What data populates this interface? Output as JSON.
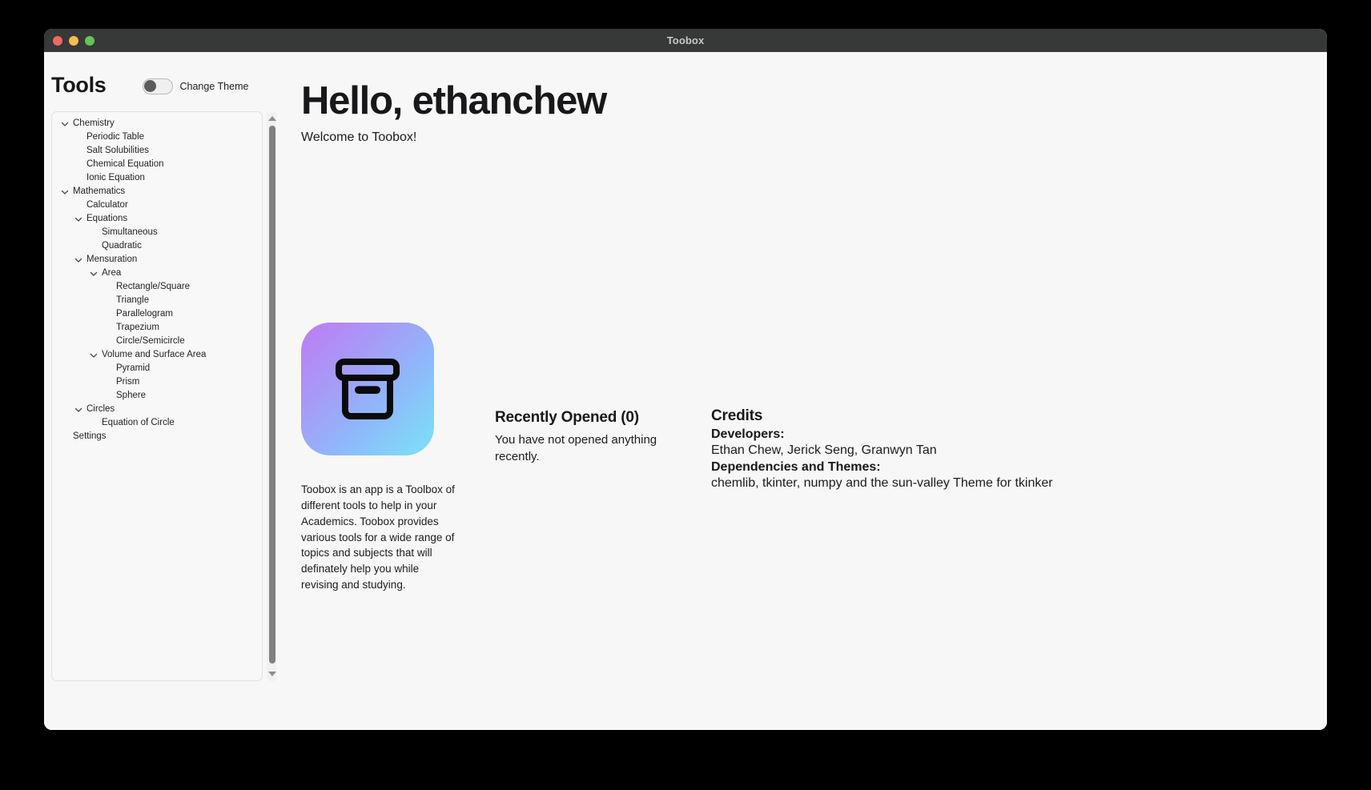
{
  "window": {
    "title": "Toobox",
    "traffic_lights": [
      "close",
      "minimize",
      "zoom"
    ]
  },
  "sidebar": {
    "title": "Tools",
    "theme_toggle_label": "Change Theme",
    "theme_toggle_state": "off",
    "tree": [
      {
        "label": "Chemistry",
        "level": 0,
        "expandable": true
      },
      {
        "label": "Periodic Table",
        "level": 1,
        "expandable": false
      },
      {
        "label": "Salt Solubilities",
        "level": 1,
        "expandable": false
      },
      {
        "label": "Chemical Equation",
        "level": 1,
        "expandable": false
      },
      {
        "label": "Ionic Equation",
        "level": 1,
        "expandable": false
      },
      {
        "label": "Mathematics",
        "level": 0,
        "expandable": true
      },
      {
        "label": "Calculator",
        "level": 1,
        "expandable": false
      },
      {
        "label": "Equations",
        "level": 1,
        "expandable": true
      },
      {
        "label": "Simultaneous",
        "level": 2,
        "expandable": false
      },
      {
        "label": "Quadratic",
        "level": 2,
        "expandable": false
      },
      {
        "label": "Mensuration",
        "level": 1,
        "expandable": true
      },
      {
        "label": "Area",
        "level": 2,
        "expandable": true
      },
      {
        "label": "Rectangle/Square",
        "level": 3,
        "expandable": false
      },
      {
        "label": "Triangle",
        "level": 3,
        "expandable": false
      },
      {
        "label": "Parallelogram",
        "level": 3,
        "expandable": false
      },
      {
        "label": "Trapezium",
        "level": 3,
        "expandable": false
      },
      {
        "label": "Circle/Semicircle",
        "level": 3,
        "expandable": false
      },
      {
        "label": "Volume and Surface Area",
        "level": 2,
        "expandable": true
      },
      {
        "label": "Pyramid",
        "level": 3,
        "expandable": false
      },
      {
        "label": "Prism",
        "level": 3,
        "expandable": false
      },
      {
        "label": "Sphere",
        "level": 3,
        "expandable": false
      },
      {
        "label": "Circles",
        "level": 1,
        "expandable": true
      },
      {
        "label": "Equation of Circle",
        "level": 2,
        "expandable": false
      },
      {
        "label": "Settings",
        "level": 0,
        "expandable": false
      }
    ],
    "scrollbar": {
      "up_arrow": "triangle-up-icon",
      "down_arrow": "triangle-down-icon"
    }
  },
  "main": {
    "greeting": "Hello, ethanchew",
    "welcome": "Welcome to Toobox!",
    "about": {
      "icon": "archive-box-icon",
      "icon_gradient_from": "#79e4f5",
      "icon_gradient_to": "#bf7bf4",
      "description": "Toobox is an app is a Toolbox of different tools to help in your Academics. Toobox provides various tools for a wide range of topics and subjects that will definately help you while revising and studying."
    },
    "recent": {
      "title": "Recently Opened (0)",
      "empty_message": "You have not opened anything recently."
    },
    "credits": {
      "title": "Credits",
      "developers_label": "Developers:",
      "developers_value": "Ethan Chew, Jerick Seng, Granwyn Tan",
      "dependencies_label": "Dependencies and Themes:",
      "dependencies_value": "chemlib, tkinter, numpy and the sun-valley Theme for tkinker"
    }
  }
}
